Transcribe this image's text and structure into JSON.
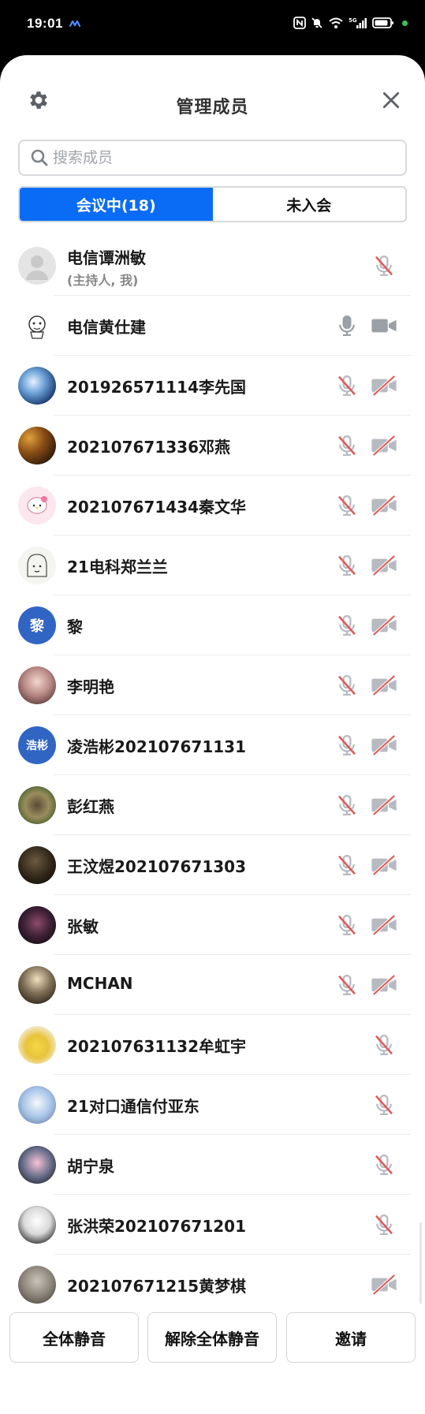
{
  "status_bar": {
    "time": "19:01",
    "icons": [
      "app-wave-icon",
      "nfc-icon",
      "mute-bell-icon",
      "wifi-icon",
      "5g-signal-icon",
      "battery-icon",
      "active-dot-icon"
    ]
  },
  "header": {
    "title": "管理成员",
    "settings_icon": "gear-icon",
    "close_icon": "close-icon"
  },
  "search": {
    "placeholder": "搜索成员",
    "value": ""
  },
  "tabs": [
    {
      "label": "会议中(18)",
      "active": true
    },
    {
      "label": "未入会",
      "active": false
    }
  ],
  "colors": {
    "accent": "#0a6cf5",
    "muted_red": "#e05a5a",
    "icon_gray": "#b7bbc1",
    "text_avatar_bg": "#3165c4"
  },
  "members": [
    {
      "name": "电信谭洲敏",
      "subtitle": "(主持人, 我)",
      "avatar": "default-person",
      "mic": "muted",
      "cam": "none"
    },
    {
      "name": "电信黄仕建",
      "avatar": "cartoon-sheep",
      "mic": "on",
      "cam": "on"
    },
    {
      "name": "201926571114李先国",
      "avatar": "photo-blue-abstract",
      "mic": "muted",
      "cam": "off"
    },
    {
      "name": "202107671336邓燕",
      "avatar": "photo-fruit",
      "mic": "muted",
      "cam": "off"
    },
    {
      "name": "202107671434秦文华",
      "avatar": "hello-kitty",
      "mic": "muted",
      "cam": "off"
    },
    {
      "name": "21电科郑兰兰",
      "avatar": "sketch-girl",
      "mic": "muted",
      "cam": "off"
    },
    {
      "name": "黎",
      "avatar": "text",
      "avatar_text": "黎",
      "mic": "muted",
      "cam": "off"
    },
    {
      "name": "李明艳",
      "avatar": "photo-girl",
      "mic": "muted",
      "cam": "off"
    },
    {
      "name": "凌浩彬202107671131",
      "avatar": "text",
      "avatar_text": "浩彬",
      "mic": "muted",
      "cam": "off"
    },
    {
      "name": "彭红燕",
      "avatar": "photo-outdoor",
      "mic": "muted",
      "cam": "off"
    },
    {
      "name": "王汶煜202107671303",
      "avatar": "photo-dark",
      "mic": "muted",
      "cam": "off"
    },
    {
      "name": "张敏",
      "avatar": "photo-night",
      "mic": "muted",
      "cam": "off"
    },
    {
      "name": "MCHAN",
      "avatar": "photo-sunset",
      "mic": "muted",
      "cam": "off"
    },
    {
      "name": "202107631132牟虹宇",
      "avatar": "pikachu",
      "mic": "muted",
      "cam": "none"
    },
    {
      "name": "21对口通信付亚东",
      "avatar": "anime-girl",
      "mic": "muted",
      "cam": "none"
    },
    {
      "name": "胡宁泉",
      "avatar": "anime-pink",
      "mic": "muted",
      "cam": "none"
    },
    {
      "name": "张洪荣202107671201",
      "avatar": "anime-white-hair",
      "mic": "muted",
      "cam": "none"
    },
    {
      "name": "202107671215黄梦棋",
      "avatar": "photo-gray",
      "mic": "none",
      "cam": "off"
    }
  ],
  "bottom_actions": [
    {
      "label": "全体静音"
    },
    {
      "label": "解除全体静音"
    },
    {
      "label": "邀请"
    }
  ]
}
